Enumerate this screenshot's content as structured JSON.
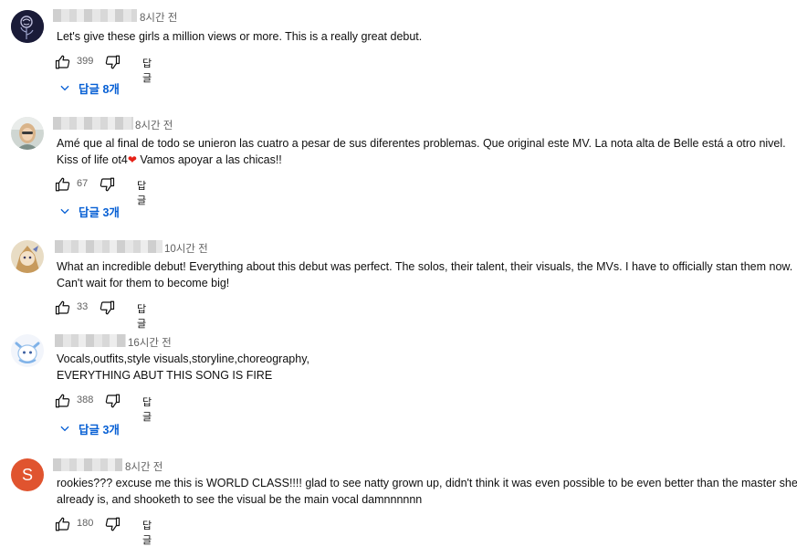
{
  "colors": {
    "link": "#065fd4",
    "secondary": "#606060",
    "avatar_s": "#e0542f"
  },
  "comments": [
    {
      "time": "8시간 전",
      "lines": [
        "Let's give these girls a million views or more. This is a really great debut."
      ],
      "likes": "399",
      "reply_label": "답글",
      "replies": "답글 8개",
      "avatar": "rose-avatar"
    },
    {
      "time": "8시간 전",
      "lines": [
        "Amé que al final de todo se unieron las cuatro a pesar de sus diferentes problemas. Que original este MV. La nota alta de Belle está a otro nivel.",
        "Kiss of life ot4",
        "Vamos apoyar a las chicas!!"
      ],
      "likes": "67",
      "reply_label": "답글",
      "replies": "답글 3개",
      "avatar": "photo-avatar"
    },
    {
      "time": "10시간 전",
      "lines": [
        "What an incredible debut! Everything about this debut was perfect. The solos, their talent, their visuals, the MVs. I have to officially stan them now.",
        "Can't wait for them to become big!"
      ],
      "likes": "33",
      "reply_label": "답글",
      "avatar": "cartoon-avatar"
    },
    {
      "time": "16시간 전",
      "lines": [
        "Vocals,outfits,style visuals,storyline,choreography,",
        "EVERYTHING ABUT THIS SONG IS FIRE"
      ],
      "likes": "388",
      "reply_label": "답글",
      "replies": "답글 3개",
      "avatar": "creature-avatar"
    },
    {
      "time": "8시간 전",
      "lines": [
        "rookies??? excuse me this is WORLD CLASS!!!! glad to see natty grown up, didn't think it was even possible to be even better than the master she",
        "already is, and shooketh to see the visual be the main vocal damnnnnnn"
      ],
      "likes": "180",
      "reply_label": "답글",
      "avatar_letter": "S"
    }
  ]
}
